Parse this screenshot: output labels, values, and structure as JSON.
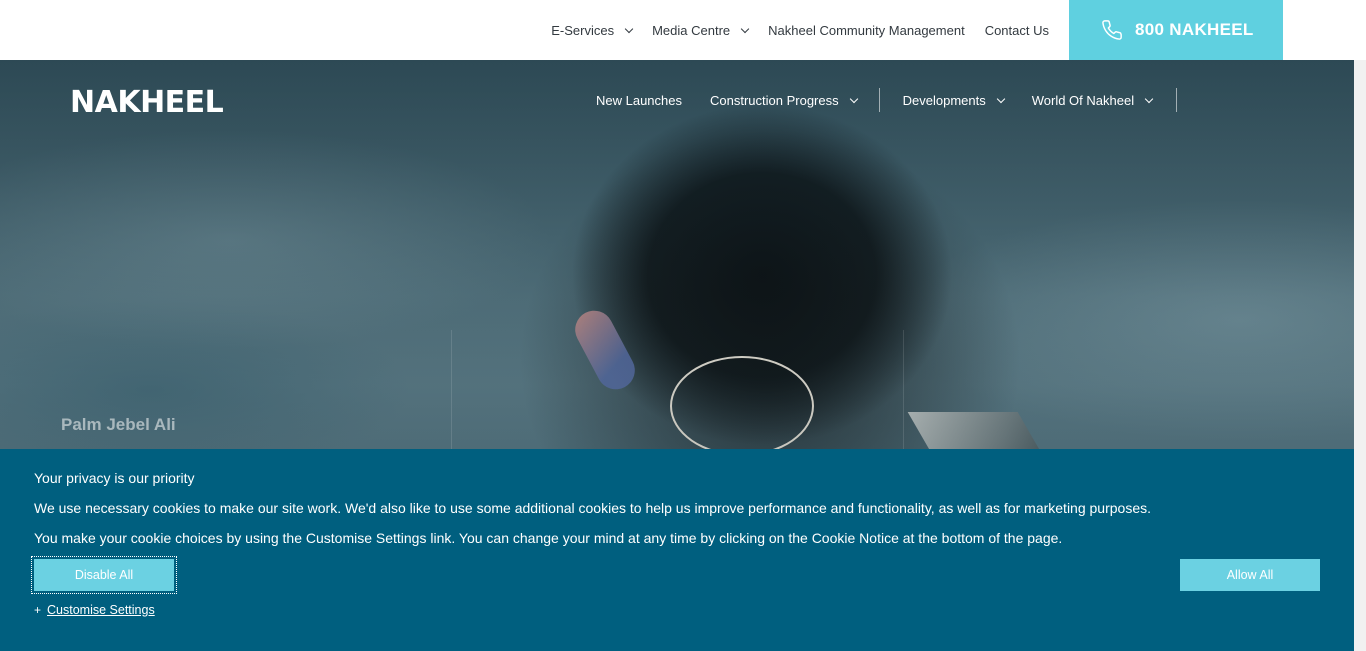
{
  "top_nav": {
    "items": [
      {
        "label": "E-Services",
        "has_dropdown": true
      },
      {
        "label": "Media Centre",
        "has_dropdown": true
      },
      {
        "label": "Nakheel Community Management",
        "has_dropdown": false
      },
      {
        "label": "Contact Us",
        "has_dropdown": false
      }
    ],
    "phone_label": "800 NAKHEEL",
    "phone_icon": "phone-icon"
  },
  "header": {
    "logo_text": "NAKHEEL",
    "nav": [
      {
        "label": "New Launches",
        "has_dropdown": false
      },
      {
        "label": "Construction Progress",
        "has_dropdown": true
      },
      {
        "label": "Developments",
        "has_dropdown": true
      },
      {
        "label": "World Of Nakheel",
        "has_dropdown": true
      }
    ]
  },
  "hero": {
    "caption": "Palm Jebel Ali"
  },
  "cookie_banner": {
    "title": "Your privacy is our priority",
    "paragraph_1": "We use necessary cookies to make our site work. We'd also like to use some additional cookies to help us improve performance and functionality, as well as for marketing purposes.",
    "paragraph_2": "You make your cookie choices by using the Customise Settings link. You can change your mind at any time by clicking on the Cookie Notice at the bottom of the page.",
    "disable_label": "Disable All",
    "allow_label": "Allow All",
    "customise_prefix": "+",
    "customise_label": "Customise Settings"
  },
  "colors": {
    "accent": "#5fd0e0",
    "banner": "#005f7f",
    "button": "#6bd1e2"
  }
}
